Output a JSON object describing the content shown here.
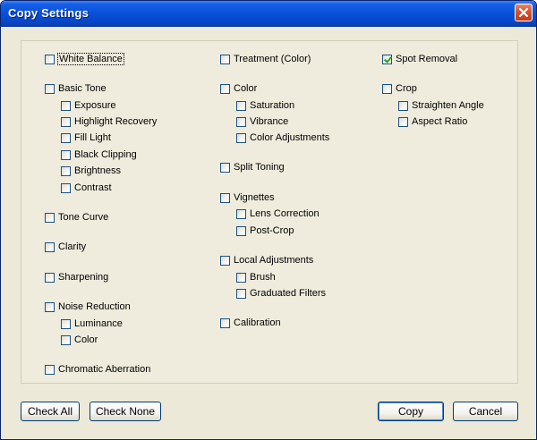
{
  "window": {
    "title": "Copy Settings"
  },
  "columns": {
    "left": [
      {
        "label": "White Balance",
        "checked": false,
        "focused": true
      },
      {
        "label": "Basic Tone",
        "checked": false
      },
      {
        "label": "Exposure",
        "checked": false
      },
      {
        "label": "Highlight Recovery",
        "checked": false
      },
      {
        "label": "Fill Light",
        "checked": false
      },
      {
        "label": "Black Clipping",
        "checked": false
      },
      {
        "label": "Brightness",
        "checked": false
      },
      {
        "label": "Contrast",
        "checked": false
      },
      {
        "label": "Tone Curve",
        "checked": false
      },
      {
        "label": "Clarity",
        "checked": false
      },
      {
        "label": "Sharpening",
        "checked": false
      },
      {
        "label": "Noise Reduction",
        "checked": false
      },
      {
        "label": "Luminance",
        "checked": false
      },
      {
        "label": "Color",
        "checked": false
      },
      {
        "label": "Chromatic Aberration",
        "checked": false
      }
    ],
    "middle": [
      {
        "label": "Treatment (Color)",
        "checked": false
      },
      {
        "label": "Color",
        "checked": false
      },
      {
        "label": "Saturation",
        "checked": false
      },
      {
        "label": "Vibrance",
        "checked": false
      },
      {
        "label": "Color Adjustments",
        "checked": false
      },
      {
        "label": "Split Toning",
        "checked": false
      },
      {
        "label": "Vignettes",
        "checked": false
      },
      {
        "label": "Lens Correction",
        "checked": false
      },
      {
        "label": "Post-Crop",
        "checked": false
      },
      {
        "label": "Local Adjustments",
        "checked": false
      },
      {
        "label": "Brush",
        "checked": false
      },
      {
        "label": "Graduated Filters",
        "checked": false
      },
      {
        "label": "Calibration",
        "checked": false
      }
    ],
    "right": [
      {
        "label": "Spot Removal",
        "checked": true
      },
      {
        "label": "Crop",
        "checked": false
      },
      {
        "label": "Straighten Angle",
        "checked": false
      },
      {
        "label": "Aspect Ratio",
        "checked": false
      }
    ]
  },
  "buttons": {
    "check_all": "Check All",
    "check_none": "Check None",
    "copy": "Copy",
    "cancel": "Cancel"
  },
  "colors": {
    "titlebar": "#0a50d8",
    "dialog_bg": "#ece9d8",
    "check_mark": "#21a121"
  }
}
